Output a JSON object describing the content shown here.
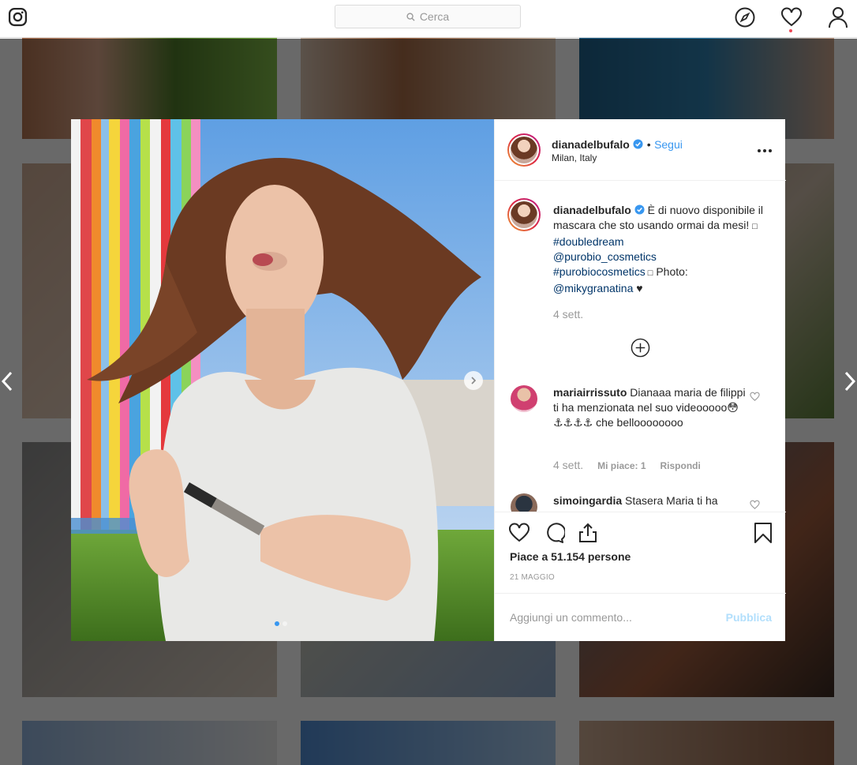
{
  "header": {
    "search_placeholder": "Cerca"
  },
  "post": {
    "username": "dianadelbufalo",
    "separator": "•",
    "follow_label": "Segui",
    "location": "Milan, Italy",
    "caption_user": "dianadelbufalo",
    "caption_text_1": " È di nuovo disponibile il mascara che sto usando ormai da mesi! ",
    "caption_tag_1": "#doubledream",
    "caption_mention_1": "@purobio_cosmetics",
    "caption_tag_2": "#purobiocosmetics",
    "caption_text_2": " Photo: ",
    "caption_mention_2": "@mikygranatina",
    "caption_heart": " ♥",
    "caption_time": "4 sett.",
    "likes": "Piace a 51.154 persone",
    "date": "21 MAGGIO"
  },
  "comments": [
    {
      "user": "mariairrissuto",
      "text": " Dianaaa maria de filippi ti ha menzionata nel suo videooooo😳⚓⚓⚓⚓ che belloooooooo",
      "time": "4 sett.",
      "likes": "Mi piace: 1",
      "reply": "Rispondi"
    },
    {
      "user": "simoingardia",
      "text": " Stasera Maria ti ha"
    }
  ],
  "add_comment": {
    "placeholder": "Aggiungi un commento...",
    "publish_label": "Pubblica"
  },
  "colors": {
    "accent": "#3897f0",
    "hashtag": "#003569",
    "muted": "#999999"
  }
}
